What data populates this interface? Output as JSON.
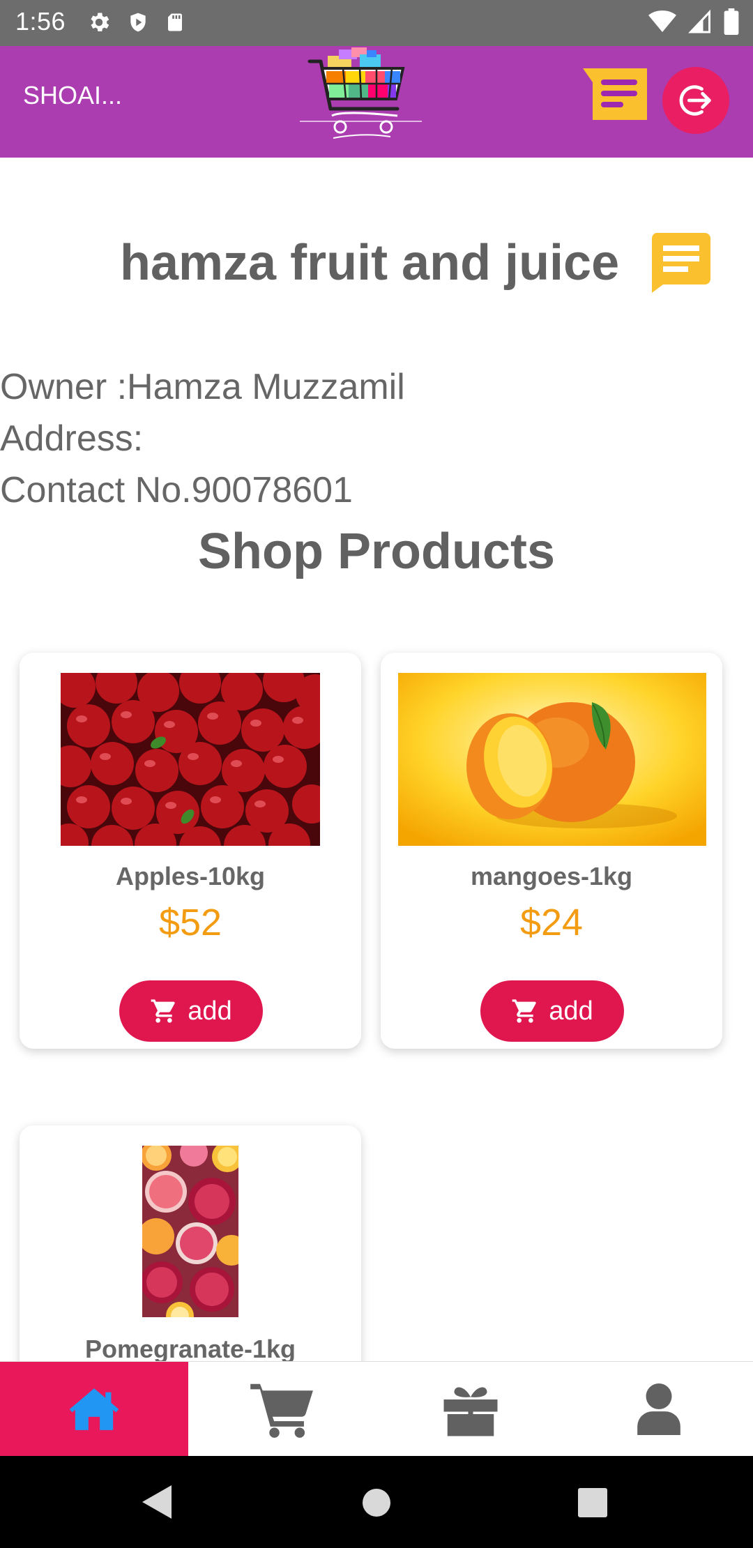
{
  "status_bar": {
    "time": "1:56",
    "icons": [
      "settings-icon",
      "shield-icon",
      "sd-card-icon",
      "wifi-icon",
      "signal-icon",
      "battery-icon"
    ]
  },
  "app_bar": {
    "user_name": "SHOAI...",
    "logo": "shopping-cart-logo",
    "colors": {
      "background": "#ab3db0",
      "logout": "#e91e63",
      "notes": "#fbc02d"
    }
  },
  "shop": {
    "name": "hamza fruit and juice",
    "owner": "Owner :Hamza Muzzamil",
    "address": "Address:",
    "contact": "Contact No.90078601"
  },
  "products_section": {
    "title": "Shop Products",
    "add_label": "add",
    "items": [
      {
        "name": "Apples-10kg",
        "price": "$52",
        "image": "apples"
      },
      {
        "name": "mangoes-1kg",
        "price": "$24",
        "image": "mangoes"
      },
      {
        "name": "Pomegranate-1kg",
        "price": "",
        "image": "pomegranate"
      }
    ]
  },
  "bottom_nav": {
    "tabs": [
      "home-icon",
      "cart-icon",
      "gift-icon",
      "profile-icon"
    ],
    "active": "home-icon",
    "colors": {
      "active_bg": "#e9185b",
      "active_icon": "#2196f3",
      "inactive_icon": "#616161"
    }
  },
  "colors": {
    "price": "#f39c12",
    "add_button": "#e0174f"
  }
}
